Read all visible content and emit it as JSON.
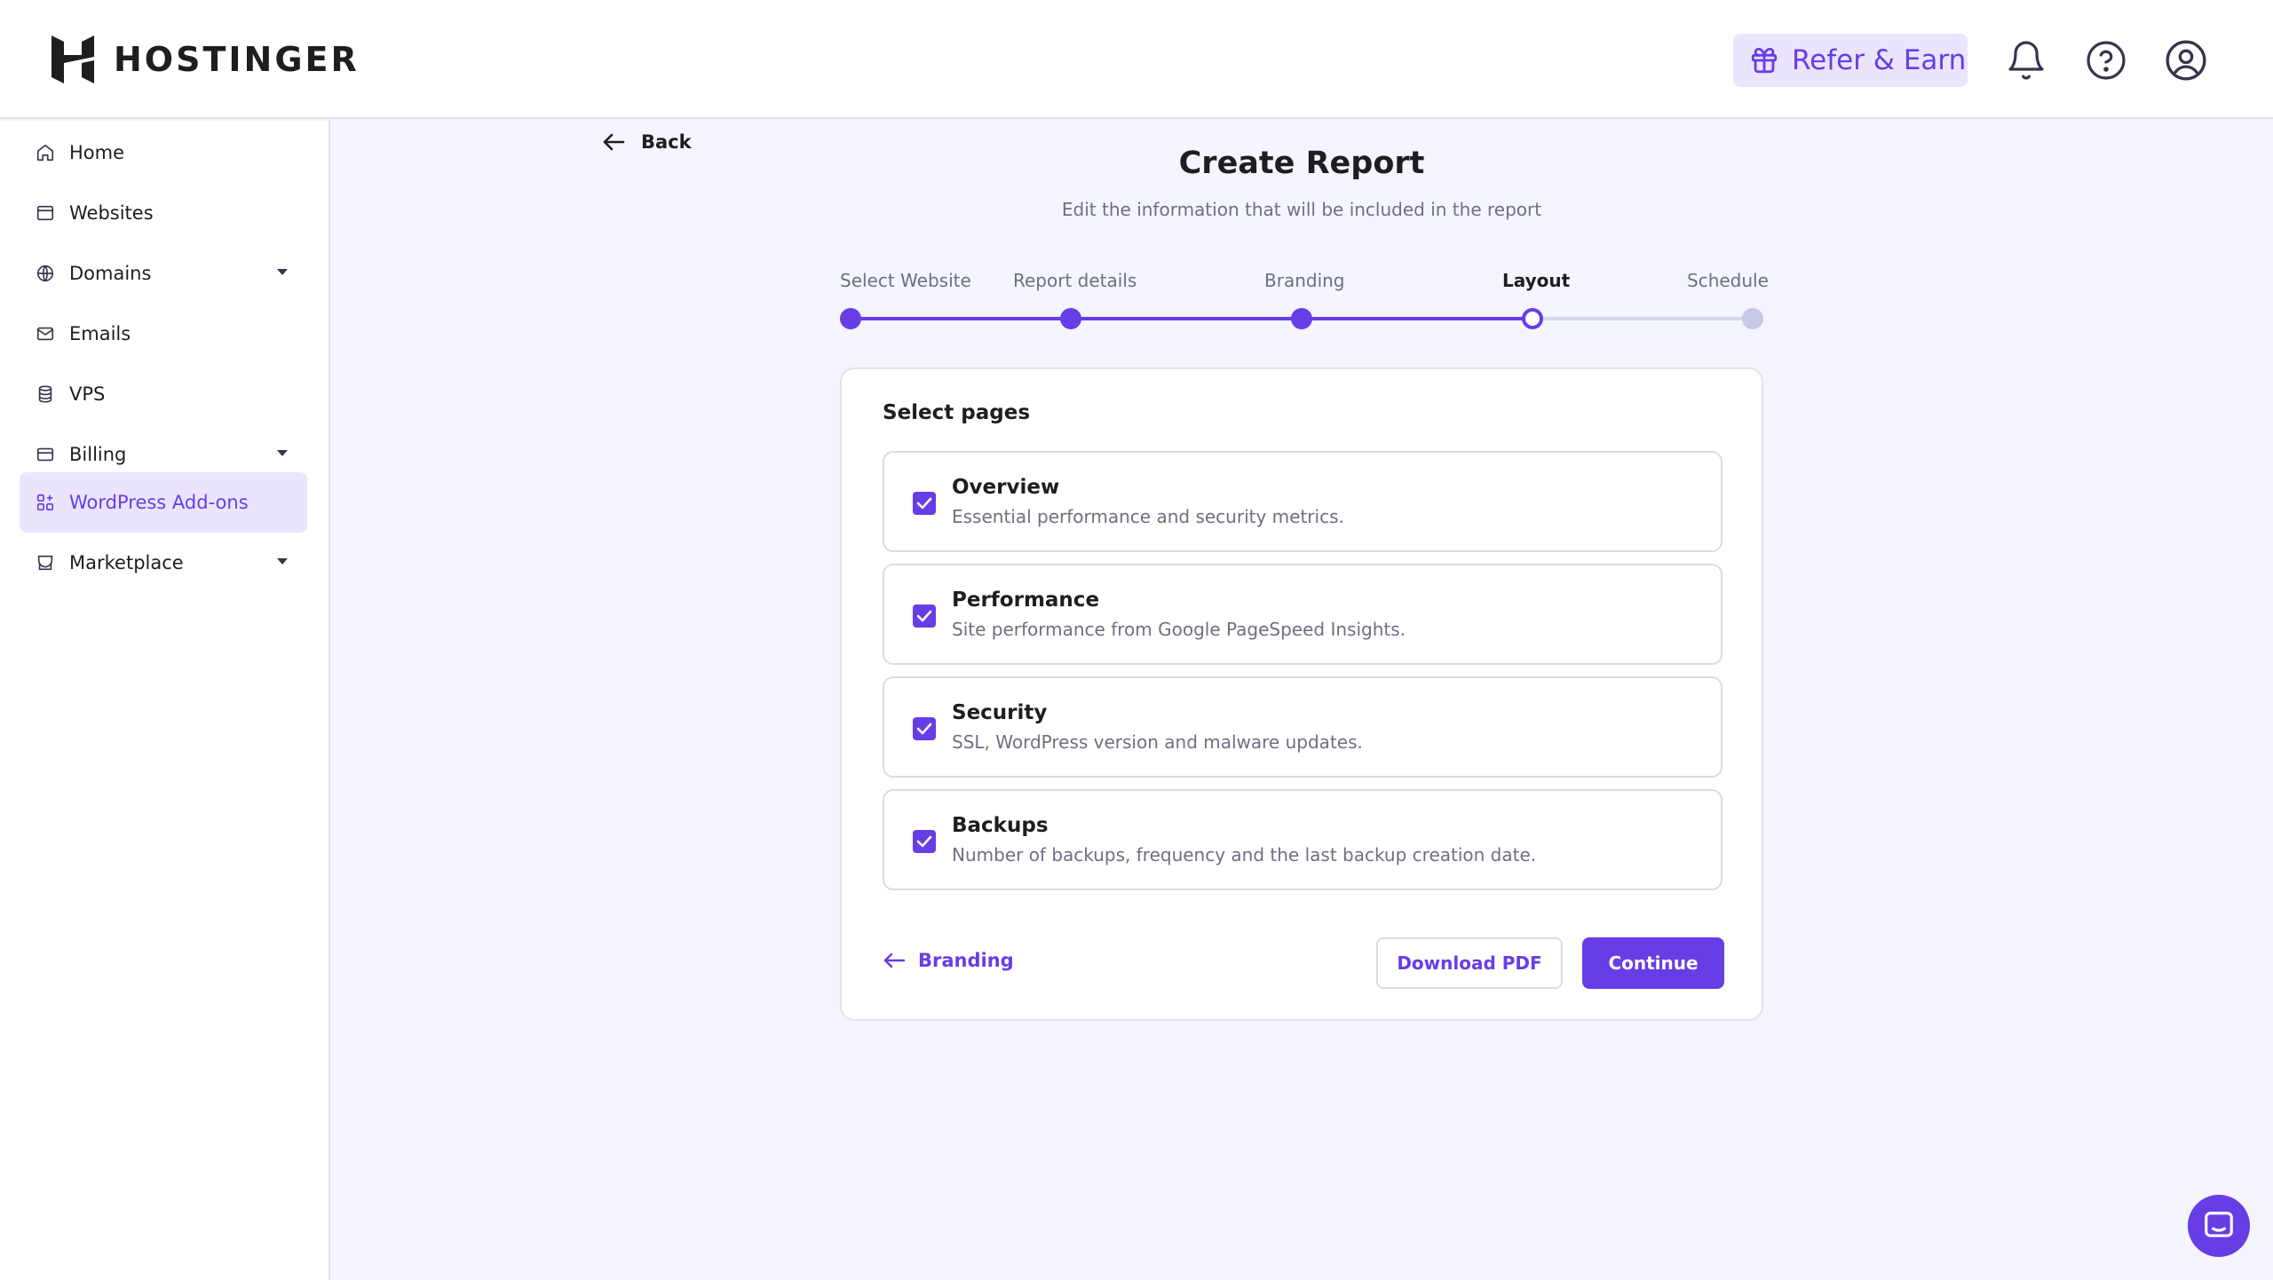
{
  "header": {
    "brand": "HOSTINGER",
    "refer_label": "Refer & Earn"
  },
  "sidebar": {
    "items": [
      {
        "label": "Home",
        "icon": "home-icon"
      },
      {
        "label": "Websites",
        "icon": "browser-icon"
      },
      {
        "label": "Domains",
        "icon": "globe-icon",
        "expandable": true
      },
      {
        "label": "Emails",
        "icon": "mail-icon"
      },
      {
        "label": "VPS",
        "icon": "server-icon"
      },
      {
        "label": "Billing",
        "icon": "card-icon",
        "expandable": true
      },
      {
        "label": "WordPress Add-ons",
        "icon": "addons-icon",
        "active": true
      },
      {
        "label": "Marketplace",
        "icon": "store-icon",
        "expandable": true
      }
    ]
  },
  "main": {
    "back_label": "Back",
    "title": "Create Report",
    "subtitle": "Edit the information that will be included in the report",
    "steps": [
      {
        "label": "Select Website",
        "state": "done"
      },
      {
        "label": "Report details",
        "state": "done"
      },
      {
        "label": "Branding",
        "state": "done"
      },
      {
        "label": "Layout",
        "state": "current"
      },
      {
        "label": "Schedule",
        "state": "upcoming"
      }
    ],
    "card": {
      "title": "Select pages",
      "pages": [
        {
          "title": "Overview",
          "description": "Essential performance and security metrics.",
          "checked": true
        },
        {
          "title": "Performance",
          "description": "Site performance from Google PageSpeed Insights.",
          "checked": true
        },
        {
          "title": "Security",
          "description": "SSL, WordPress version and malware updates.",
          "checked": true
        },
        {
          "title": "Backups",
          "description": "Number of backups, frequency and the last backup creation date.",
          "checked": true
        }
      ],
      "prev_label": "Branding",
      "download_label": "Download PDF",
      "continue_label": "Continue"
    }
  },
  "colors": {
    "accent": "#673de6",
    "accent_light": "#ebe4ff",
    "upcoming": "#c5cbe6"
  }
}
